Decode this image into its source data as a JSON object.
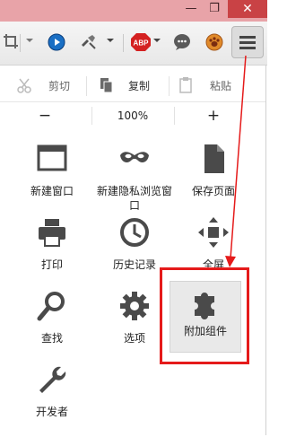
{
  "window": {
    "min_glyph": "—",
    "restore_glyph": "❐",
    "close_glyph": "✕"
  },
  "toolbar": {
    "icons": [
      "crop-icon",
      "chevron-down-icon",
      "blue-play-icon",
      "tools-icon",
      "chevron-down-icon",
      "adblock-plus-icon",
      "chevron-down-icon",
      "chat-icon",
      "paw-icon",
      "hamburger-menu-icon"
    ],
    "abp_label": "ABP"
  },
  "menu": {
    "edit": {
      "cut": "剪切",
      "copy": "复制",
      "paste": "粘贴"
    },
    "zoom": {
      "minus": "−",
      "value": "100%",
      "plus": "+"
    },
    "items": [
      {
        "label": "新建窗口",
        "icon": "new-window-icon"
      },
      {
        "label": "新建隐私浏览窗口",
        "icon": "private-mask-icon"
      },
      {
        "label": "保存页面",
        "icon": "save-page-icon"
      },
      {
        "label": "打印",
        "icon": "printer-icon"
      },
      {
        "label": "历史记录",
        "icon": "history-clock-icon"
      },
      {
        "label": "全屏",
        "icon": "fullscreen-icon"
      },
      {
        "label": "查找",
        "icon": "search-icon"
      },
      {
        "label": "选项",
        "icon": "gear-icon"
      },
      {
        "label": "附加组件",
        "icon": "puzzle-icon"
      },
      {
        "label": "开发者",
        "icon": "wrench-icon"
      }
    ]
  },
  "annotation": {
    "color": "#e51a1a"
  }
}
